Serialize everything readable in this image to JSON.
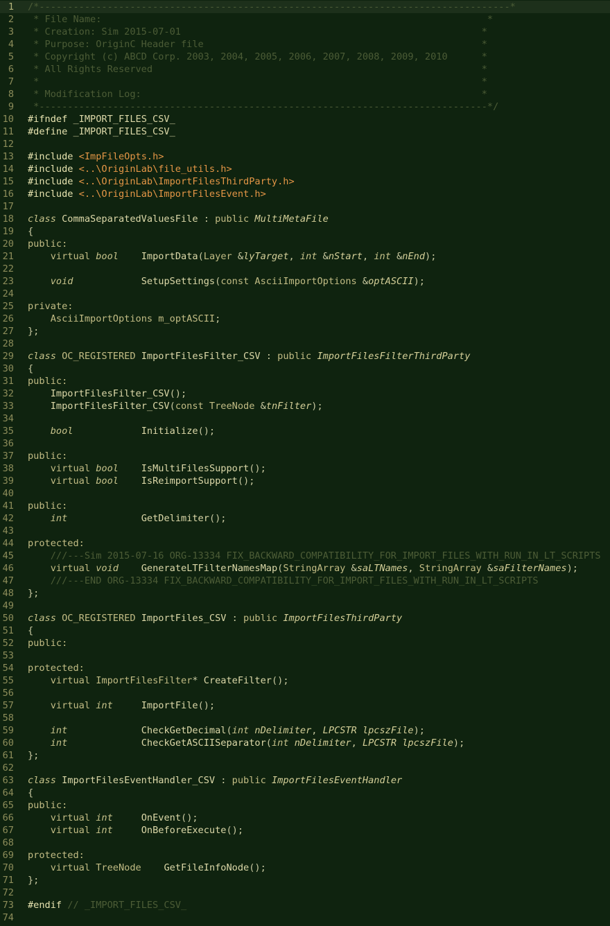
{
  "colors": {
    "background": "#0f230f",
    "current_line": "#1d301b",
    "line_number": "#8d8d5a",
    "comment": "#4c5c36",
    "preprocessor": "#e8e4b0",
    "header_path": "#e49646",
    "keyword": "#c6c28a",
    "identifier": "#dcd8a8"
  },
  "current_line": 1,
  "lines": [
    {
      "n": "1",
      "tokens": [
        [
          "comment",
          "/*-----------------------------------------------------------------------------------*"
        ]
      ]
    },
    {
      "n": "2",
      "tokens": [
        [
          "comment",
          " * File Name:                                                                    *"
        ]
      ]
    },
    {
      "n": "3",
      "tokens": [
        [
          "comment",
          " * Creation: Sim 2015-07-01                                                     *"
        ]
      ]
    },
    {
      "n": "4",
      "tokens": [
        [
          "comment",
          " * Purpose: OriginC Header file                                                 *"
        ]
      ]
    },
    {
      "n": "5",
      "tokens": [
        [
          "comment",
          " * Copyright (c) ABCD Corp. 2003, 2004, 2005, 2006, 2007, 2008, 2009, 2010      *"
        ]
      ]
    },
    {
      "n": "6",
      "tokens": [
        [
          "comment",
          " * All Rights Reserved                                                          *"
        ]
      ]
    },
    {
      "n": "7",
      "tokens": [
        [
          "comment",
          " *                                                                              *"
        ]
      ]
    },
    {
      "n": "8",
      "tokens": [
        [
          "comment",
          " * Modification Log:                                                            *"
        ]
      ]
    },
    {
      "n": "9",
      "tokens": [
        [
          "comment",
          " *-------------------------------------------------------------------------------*/"
        ]
      ]
    },
    {
      "n": "10",
      "tokens": [
        [
          "pp",
          "#ifndef "
        ],
        [
          "ident",
          "_IMPORT_FILES_CSV_"
        ]
      ]
    },
    {
      "n": "11",
      "tokens": [
        [
          "pp",
          "#define "
        ],
        [
          "ident",
          "_IMPORT_FILES_CSV_"
        ]
      ]
    },
    {
      "n": "12",
      "tokens": []
    },
    {
      "n": "13",
      "tokens": [
        [
          "pp",
          "#include "
        ],
        [
          "header",
          "<ImpFileOpts.h>"
        ]
      ]
    },
    {
      "n": "14",
      "tokens": [
        [
          "pp",
          "#include "
        ],
        [
          "header",
          "<..\\OriginLab\\file_utils.h>"
        ]
      ]
    },
    {
      "n": "15",
      "tokens": [
        [
          "pp",
          "#include "
        ],
        [
          "header",
          "<..\\OriginLab\\ImportFilesThirdParty.h>"
        ]
      ]
    },
    {
      "n": "16",
      "tokens": [
        [
          "pp",
          "#include "
        ],
        [
          "header",
          "<..\\OriginLab\\ImportFilesEvent.h>"
        ]
      ]
    },
    {
      "n": "17",
      "tokens": []
    },
    {
      "n": "18",
      "tokens": [
        [
          "kw",
          "class"
        ],
        [
          "punct",
          " "
        ],
        [
          "ident",
          "CommaSeparatedValuesFile"
        ],
        [
          "punct",
          " : "
        ],
        [
          "kw2",
          "public"
        ],
        [
          "punct",
          " "
        ],
        [
          "param",
          "MultiMetaFile"
        ]
      ]
    },
    {
      "n": "19",
      "tokens": [
        [
          "punct",
          "{"
        ]
      ]
    },
    {
      "n": "20",
      "tokens": [
        [
          "kw2",
          "public:"
        ]
      ]
    },
    {
      "n": "21",
      "tokens": [
        [
          "punct",
          "    "
        ],
        [
          "kw2",
          "virtual"
        ],
        [
          "punct",
          " "
        ],
        [
          "kw",
          "bool"
        ],
        [
          "punct",
          "    "
        ],
        [
          "ident",
          "ImportData"
        ],
        [
          "punct",
          "("
        ],
        [
          "type",
          "Layer"
        ],
        [
          "punct",
          " &"
        ],
        [
          "param",
          "lyTarget"
        ],
        [
          "punct",
          ", "
        ],
        [
          "kw",
          "int"
        ],
        [
          "punct",
          " &"
        ],
        [
          "param",
          "nStart"
        ],
        [
          "punct",
          ", "
        ],
        [
          "kw",
          "int"
        ],
        [
          "punct",
          " &"
        ],
        [
          "param",
          "nEnd"
        ],
        [
          "punct",
          ");"
        ]
      ]
    },
    {
      "n": "22",
      "tokens": []
    },
    {
      "n": "23",
      "tokens": [
        [
          "punct",
          "    "
        ],
        [
          "kw",
          "void"
        ],
        [
          "punct",
          "            "
        ],
        [
          "ident",
          "SetupSettings"
        ],
        [
          "punct",
          "("
        ],
        [
          "kw2",
          "const"
        ],
        [
          "punct",
          " "
        ],
        [
          "type",
          "AsciiImportOptions"
        ],
        [
          "punct",
          " &"
        ],
        [
          "param",
          "optASCII"
        ],
        [
          "punct",
          ");"
        ]
      ]
    },
    {
      "n": "24",
      "tokens": []
    },
    {
      "n": "25",
      "tokens": [
        [
          "kw2",
          "private:"
        ]
      ]
    },
    {
      "n": "26",
      "tokens": [
        [
          "punct",
          "    "
        ],
        [
          "type",
          "AsciiImportOptions"
        ],
        [
          "punct",
          " "
        ],
        [
          "type",
          "m_optASCII"
        ],
        [
          "punct",
          ";"
        ]
      ]
    },
    {
      "n": "27",
      "tokens": [
        [
          "punct",
          "};"
        ]
      ]
    },
    {
      "n": "28",
      "tokens": []
    },
    {
      "n": "29",
      "tokens": [
        [
          "kw",
          "class"
        ],
        [
          "punct",
          " "
        ],
        [
          "type",
          "OC_REGISTERED"
        ],
        [
          "punct",
          " "
        ],
        [
          "ident",
          "ImportFilesFilter_CSV"
        ],
        [
          "punct",
          " : "
        ],
        [
          "kw2",
          "public"
        ],
        [
          "punct",
          " "
        ],
        [
          "param",
          "ImportFilesFilterThirdParty"
        ]
      ]
    },
    {
      "n": "30",
      "tokens": [
        [
          "punct",
          "{"
        ]
      ]
    },
    {
      "n": "31",
      "tokens": [
        [
          "kw2",
          "public:"
        ]
      ]
    },
    {
      "n": "32",
      "tokens": [
        [
          "punct",
          "    "
        ],
        [
          "ident",
          "ImportFilesFilter_CSV"
        ],
        [
          "punct",
          "();"
        ]
      ]
    },
    {
      "n": "33",
      "tokens": [
        [
          "punct",
          "    "
        ],
        [
          "ident",
          "ImportFilesFilter_CSV"
        ],
        [
          "punct",
          "("
        ],
        [
          "kw2",
          "const"
        ],
        [
          "punct",
          " "
        ],
        [
          "type",
          "TreeNode"
        ],
        [
          "punct",
          " &"
        ],
        [
          "param",
          "tnFilter"
        ],
        [
          "punct",
          ");"
        ]
      ]
    },
    {
      "n": "34",
      "tokens": []
    },
    {
      "n": "35",
      "tokens": [
        [
          "punct",
          "    "
        ],
        [
          "kw",
          "bool"
        ],
        [
          "punct",
          "            "
        ],
        [
          "ident",
          "Initialize"
        ],
        [
          "punct",
          "();"
        ]
      ]
    },
    {
      "n": "36",
      "tokens": []
    },
    {
      "n": "37",
      "tokens": [
        [
          "kw2",
          "public:"
        ]
      ]
    },
    {
      "n": "38",
      "tokens": [
        [
          "punct",
          "    "
        ],
        [
          "kw2",
          "virtual"
        ],
        [
          "punct",
          " "
        ],
        [
          "kw",
          "bool"
        ],
        [
          "punct",
          "    "
        ],
        [
          "ident",
          "IsMultiFilesSupport"
        ],
        [
          "punct",
          "();"
        ]
      ]
    },
    {
      "n": "39",
      "tokens": [
        [
          "punct",
          "    "
        ],
        [
          "kw2",
          "virtual"
        ],
        [
          "punct",
          " "
        ],
        [
          "kw",
          "bool"
        ],
        [
          "punct",
          "    "
        ],
        [
          "ident",
          "IsReimportSupport"
        ],
        [
          "punct",
          "();"
        ]
      ]
    },
    {
      "n": "40",
      "tokens": []
    },
    {
      "n": "41",
      "tokens": [
        [
          "kw2",
          "public:"
        ]
      ]
    },
    {
      "n": "42",
      "tokens": [
        [
          "punct",
          "    "
        ],
        [
          "kw",
          "int"
        ],
        [
          "punct",
          "             "
        ],
        [
          "ident",
          "GetDelimiter"
        ],
        [
          "punct",
          "();"
        ]
      ]
    },
    {
      "n": "43",
      "tokens": []
    },
    {
      "n": "44",
      "tokens": [
        [
          "kw2",
          "protected:"
        ]
      ]
    },
    {
      "n": "45",
      "tokens": [
        [
          "punct",
          "    "
        ],
        [
          "comment",
          "///---Sim 2015-07-16 ORG-13334 FIX_BACKWARD_COMPATIBILITY_FOR_IMPORT_FILES_WITH_RUN_IN_LT_SCRIPTS"
        ]
      ]
    },
    {
      "n": "46",
      "tokens": [
        [
          "punct",
          "    "
        ],
        [
          "kw2",
          "virtual"
        ],
        [
          "punct",
          " "
        ],
        [
          "kw",
          "void"
        ],
        [
          "punct",
          "    "
        ],
        [
          "ident",
          "GenerateLTFilterNamesMap"
        ],
        [
          "punct",
          "("
        ],
        [
          "type",
          "StringArray"
        ],
        [
          "punct",
          " &"
        ],
        [
          "param",
          "saLTNames"
        ],
        [
          "punct",
          ", "
        ],
        [
          "type",
          "StringArray"
        ],
        [
          "punct",
          " &"
        ],
        [
          "param",
          "saFilterNames"
        ],
        [
          "punct",
          ");"
        ]
      ]
    },
    {
      "n": "47",
      "tokens": [
        [
          "punct",
          "    "
        ],
        [
          "comment",
          "///---END ORG-13334 FIX_BACKWARD_COMPATIBILITY_FOR_IMPORT_FILES_WITH_RUN_IN_LT_SCRIPTS"
        ]
      ]
    },
    {
      "n": "48",
      "tokens": [
        [
          "punct",
          "};"
        ]
      ]
    },
    {
      "n": "49",
      "tokens": []
    },
    {
      "n": "50",
      "tokens": [
        [
          "kw",
          "class"
        ],
        [
          "punct",
          " "
        ],
        [
          "type",
          "OC_REGISTERED"
        ],
        [
          "punct",
          " "
        ],
        [
          "ident",
          "ImportFiles_CSV"
        ],
        [
          "punct",
          " : "
        ],
        [
          "kw2",
          "public"
        ],
        [
          "punct",
          " "
        ],
        [
          "param",
          "ImportFilesThirdParty"
        ]
      ]
    },
    {
      "n": "51",
      "tokens": [
        [
          "punct",
          "{"
        ]
      ]
    },
    {
      "n": "52",
      "tokens": [
        [
          "kw2",
          "public:"
        ]
      ]
    },
    {
      "n": "53",
      "tokens": []
    },
    {
      "n": "54",
      "tokens": [
        [
          "kw2",
          "protected:"
        ]
      ]
    },
    {
      "n": "55",
      "tokens": [
        [
          "punct",
          "    "
        ],
        [
          "kw2",
          "virtual"
        ],
        [
          "punct",
          " "
        ],
        [
          "type",
          "ImportFilesFilter"
        ],
        [
          "punct",
          "* "
        ],
        [
          "ident",
          "CreateFilter"
        ],
        [
          "punct",
          "();"
        ]
      ]
    },
    {
      "n": "56",
      "tokens": []
    },
    {
      "n": "57",
      "tokens": [
        [
          "punct",
          "    "
        ],
        [
          "kw2",
          "virtual"
        ],
        [
          "punct",
          " "
        ],
        [
          "kw",
          "int"
        ],
        [
          "punct",
          "     "
        ],
        [
          "ident",
          "ImportFile"
        ],
        [
          "punct",
          "();"
        ]
      ]
    },
    {
      "n": "58",
      "tokens": []
    },
    {
      "n": "59",
      "tokens": [
        [
          "punct",
          "    "
        ],
        [
          "kw",
          "int"
        ],
        [
          "punct",
          "             "
        ],
        [
          "ident",
          "CheckGetDecimal"
        ],
        [
          "punct",
          "("
        ],
        [
          "kw",
          "int"
        ],
        [
          "punct",
          " "
        ],
        [
          "param",
          "nDelimiter"
        ],
        [
          "punct",
          ", "
        ],
        [
          "param",
          "LPCSTR"
        ],
        [
          "punct",
          " "
        ],
        [
          "param",
          "lpcszFile"
        ],
        [
          "punct",
          ");"
        ]
      ]
    },
    {
      "n": "60",
      "tokens": [
        [
          "punct",
          "    "
        ],
        [
          "kw",
          "int"
        ],
        [
          "punct",
          "             "
        ],
        [
          "ident",
          "CheckGetASCIISeparator"
        ],
        [
          "punct",
          "("
        ],
        [
          "kw",
          "int"
        ],
        [
          "punct",
          " "
        ],
        [
          "param",
          "nDelimiter"
        ],
        [
          "punct",
          ", "
        ],
        [
          "param",
          "LPCSTR"
        ],
        [
          "punct",
          " "
        ],
        [
          "param",
          "lpcszFile"
        ],
        [
          "punct",
          ");"
        ]
      ]
    },
    {
      "n": "61",
      "tokens": [
        [
          "punct",
          "};"
        ]
      ]
    },
    {
      "n": "62",
      "tokens": []
    },
    {
      "n": "63",
      "tokens": [
        [
          "kw",
          "class"
        ],
        [
          "punct",
          " "
        ],
        [
          "ident",
          "ImportFilesEventHandler_CSV"
        ],
        [
          "punct",
          " : "
        ],
        [
          "kw2",
          "public"
        ],
        [
          "punct",
          " "
        ],
        [
          "param",
          "ImportFilesEventHandler"
        ]
      ]
    },
    {
      "n": "64",
      "tokens": [
        [
          "punct",
          "{"
        ]
      ]
    },
    {
      "n": "65",
      "tokens": [
        [
          "kw2",
          "public:"
        ]
      ]
    },
    {
      "n": "66",
      "tokens": [
        [
          "punct",
          "    "
        ],
        [
          "kw2",
          "virtual"
        ],
        [
          "punct",
          " "
        ],
        [
          "kw",
          "int"
        ],
        [
          "punct",
          "     "
        ],
        [
          "ident",
          "OnEvent"
        ],
        [
          "punct",
          "();"
        ]
      ]
    },
    {
      "n": "67",
      "tokens": [
        [
          "punct",
          "    "
        ],
        [
          "kw2",
          "virtual"
        ],
        [
          "punct",
          " "
        ],
        [
          "kw",
          "int"
        ],
        [
          "punct",
          "     "
        ],
        [
          "ident",
          "OnBeforeExecute"
        ],
        [
          "punct",
          "();"
        ]
      ]
    },
    {
      "n": "68",
      "tokens": []
    },
    {
      "n": "69",
      "tokens": [
        [
          "kw2",
          "protected:"
        ]
      ]
    },
    {
      "n": "70",
      "tokens": [
        [
          "punct",
          "    "
        ],
        [
          "kw2",
          "virtual"
        ],
        [
          "punct",
          " "
        ],
        [
          "type",
          "TreeNode"
        ],
        [
          "punct",
          "    "
        ],
        [
          "ident",
          "GetFileInfoNode"
        ],
        [
          "punct",
          "();"
        ]
      ]
    },
    {
      "n": "71",
      "tokens": [
        [
          "punct",
          "};"
        ]
      ]
    },
    {
      "n": "72",
      "tokens": []
    },
    {
      "n": "73",
      "tokens": [
        [
          "pp",
          "#endif"
        ],
        [
          "punct",
          " "
        ],
        [
          "comment",
          "// _IMPORT_FILES_CSV_"
        ]
      ]
    },
    {
      "n": "74",
      "tokens": []
    }
  ]
}
